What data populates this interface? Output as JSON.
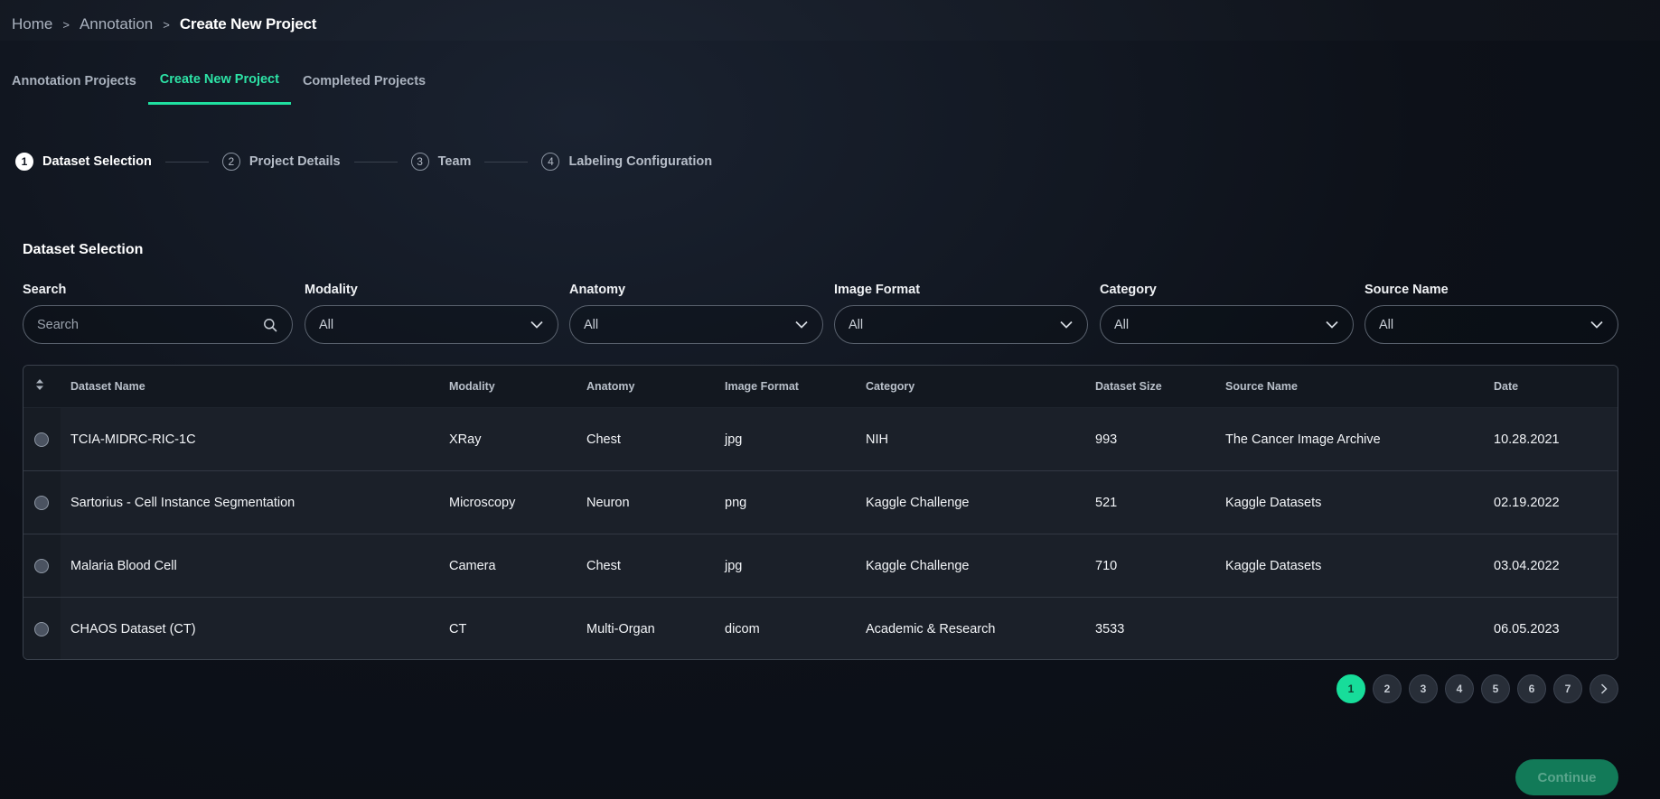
{
  "breadcrumb": {
    "home": "Home",
    "annotation": "Annotation",
    "current": "Create New Project",
    "separator": ">"
  },
  "tabs": [
    {
      "label": "Annotation Projects"
    },
    {
      "label": "Create New Project",
      "active": true
    },
    {
      "label": "Completed Projects"
    }
  ],
  "stepper": [
    {
      "num": "1",
      "label": "Dataset Selection",
      "active": true
    },
    {
      "num": "2",
      "label": "Project Details"
    },
    {
      "num": "3",
      "label": "Team"
    },
    {
      "num": "4",
      "label": "Labeling Configuration"
    }
  ],
  "section": {
    "title": "Dataset Selection"
  },
  "filters": {
    "search": {
      "label": "Search",
      "placeholder": "Search"
    },
    "modality": {
      "label": "Modality",
      "value": "All"
    },
    "anatomy": {
      "label": "Anatomy",
      "value": "All"
    },
    "image_format": {
      "label": "Image Format",
      "value": "All"
    },
    "category": {
      "label": "Category",
      "value": "All"
    },
    "source_name": {
      "label": "Source Name",
      "value": "All"
    }
  },
  "table": {
    "headers": [
      "Dataset Name",
      "Modality",
      "Anatomy",
      "Image Format",
      "Category",
      "Dataset Size",
      "Source Name",
      "Date"
    ],
    "rows": [
      [
        "TCIA-MIDRC-RIC-1C",
        "XRay",
        "Chest",
        "jpg",
        "NIH",
        "993",
        "The Cancer Image Archive",
        "10.28.2021"
      ],
      [
        "Sartorius - Cell Instance Segmentation",
        "Microscopy",
        "Neuron",
        "png",
        "Kaggle Challenge",
        "521",
        "Kaggle Datasets",
        "02.19.2022"
      ],
      [
        "Malaria Blood Cell",
        "Camera",
        "Chest",
        "jpg",
        "Kaggle Challenge",
        "710",
        "Kaggle Datasets",
        "03.04.2022"
      ],
      [
        "CHAOS Dataset (CT)",
        "CT",
        "Multi-Organ",
        "dicom",
        "Academic & Research",
        "3533",
        "",
        "06.05.2023"
      ]
    ]
  },
  "pagination": {
    "pages": [
      "1",
      "2",
      "3",
      "4",
      "5",
      "6",
      "7"
    ],
    "current": "1"
  },
  "actions": {
    "continue_label": "Continue"
  },
  "colors": {
    "accent": "#1fe0a0",
    "background": "#0d1119",
    "continue_bg": "#127a58"
  },
  "icons": {
    "search": "search-icon",
    "dropdown": "chevron-down-icon",
    "sort": "sort-icon",
    "next": "chevron-right-icon"
  }
}
